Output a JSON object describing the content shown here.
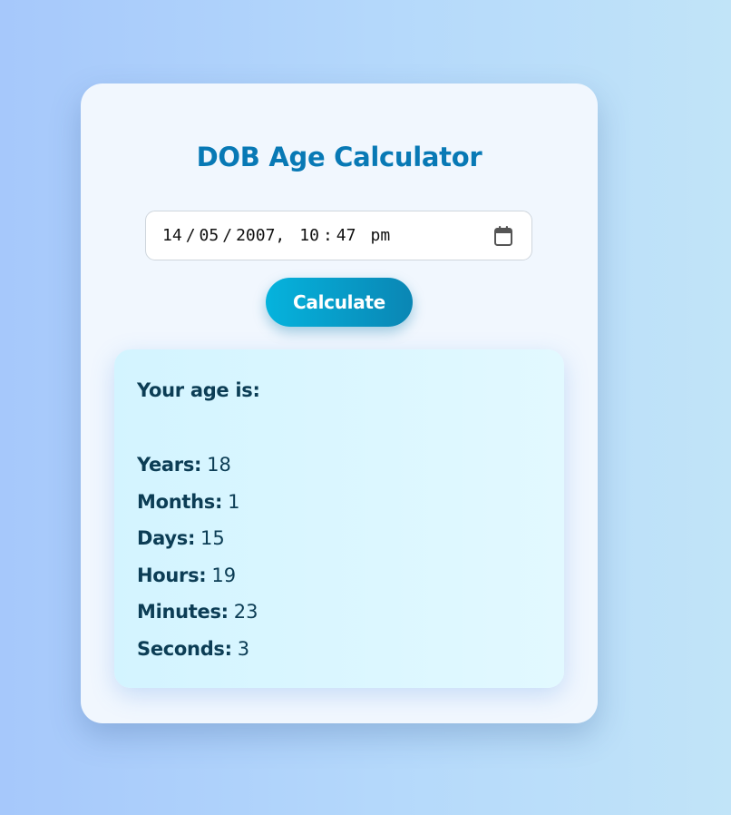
{
  "app": {
    "title": "DOB Age Calculator"
  },
  "dob_input": {
    "day": "14",
    "month": "05",
    "year": "2007",
    "hour": "10",
    "minute": "47",
    "ampm": "pm",
    "separator_date": "/",
    "separator_datetime": ",",
    "separator_time": ":",
    "icon": "calendar-icon"
  },
  "calculate_button": {
    "label": "Calculate"
  },
  "result": {
    "heading": "Your age is:",
    "rows": [
      {
        "label": "Years:",
        "value": "18"
      },
      {
        "label": "Months:",
        "value": "1"
      },
      {
        "label": "Days:",
        "value": "15"
      },
      {
        "label": "Hours:",
        "value": "19"
      },
      {
        "label": "Minutes:",
        "value": "23"
      },
      {
        "label": "Seconds:",
        "value": "3"
      }
    ]
  },
  "colors": {
    "title": "#0879b5",
    "button_start": "#05b3dd",
    "button_end": "#0a86b4",
    "result_text": "#0c3d55"
  }
}
